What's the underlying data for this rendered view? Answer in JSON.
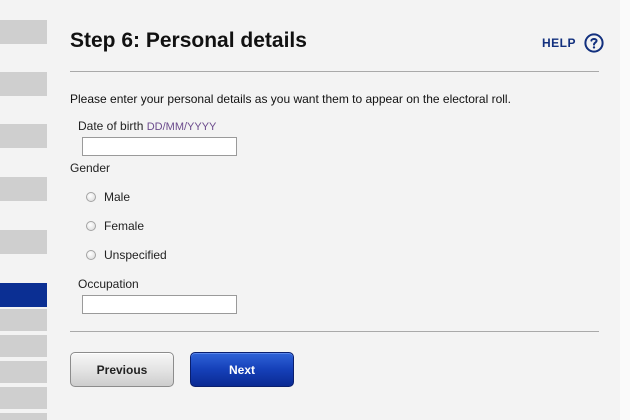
{
  "page": {
    "title": "Step 6: Personal details",
    "help_label": "HELP",
    "intro": "Please enter your personal details as you want them to appear on the electoral roll."
  },
  "sidebar": {
    "active_step_index": 9
  },
  "form": {
    "dob_label": "Date of birth",
    "dob_hint": "DD/MM/YYYY",
    "dob_value": "",
    "gender_label": "Gender",
    "gender_options": [
      "Male",
      "Female",
      "Unspecified"
    ],
    "gender_selected": null,
    "occupation_label": "Occupation",
    "occupation_value": ""
  },
  "buttons": {
    "previous": "Previous",
    "next": "Next"
  },
  "colors": {
    "accent": "#0b2f93",
    "help_text": "#12307e",
    "hint_text": "#6b4a8c"
  },
  "icons": {
    "help": "question-circle-icon"
  }
}
